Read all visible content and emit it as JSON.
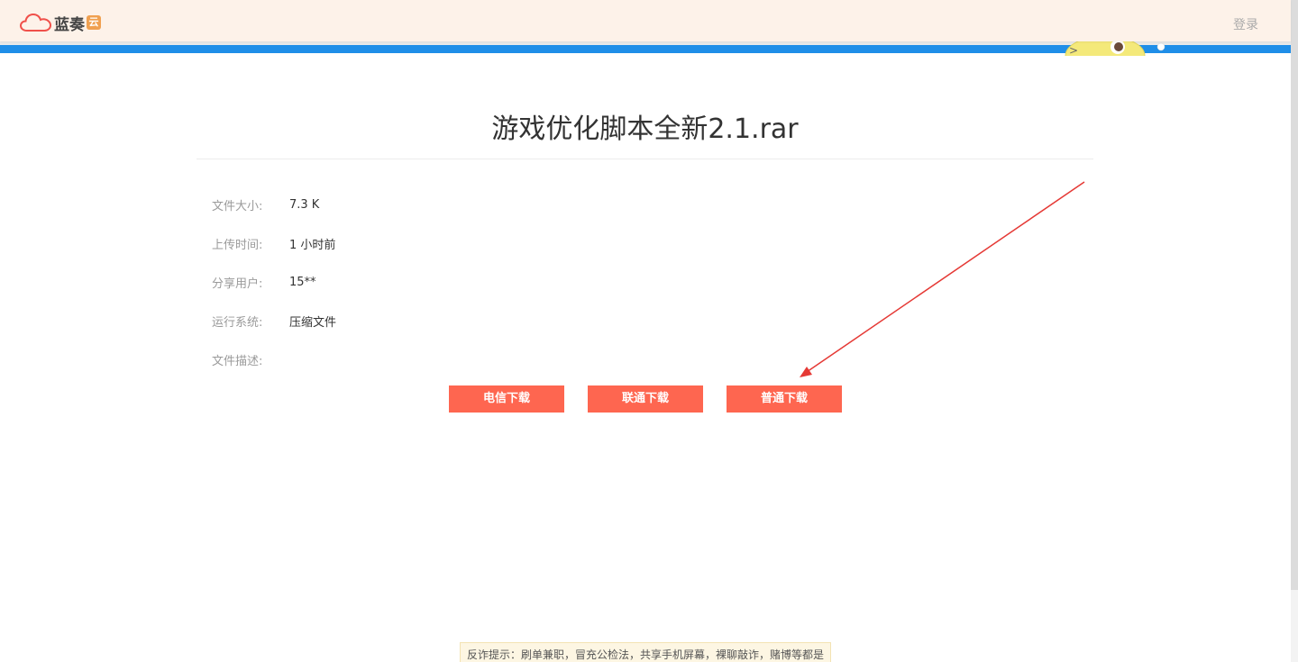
{
  "header": {
    "logo_text": "蓝奏",
    "logo_badge": "云",
    "login_label": "登录"
  },
  "file": {
    "title": "游戏优化脚本全新2.1.rar"
  },
  "info": [
    {
      "label": "文件大小:",
      "value": "7.3 K"
    },
    {
      "label": "上传时间:",
      "value": "1 小时前"
    },
    {
      "label": "分享用户:",
      "value": "15**"
    },
    {
      "label": "运行系统:",
      "value": "压缩文件"
    },
    {
      "label": "文件描述:",
      "value": ""
    }
  ],
  "buttons": {
    "telecom": "电信下载",
    "unicom": "联通下载",
    "normal": "普通下载"
  },
  "notice": {
    "text": "反诈提示：刷单兼职，冒充公检法，共享手机屏幕，裸聊敲诈，赌博等都是"
  },
  "colors": {
    "header_bg": "#fdf2e9",
    "blue_bar": "#1f8ee8",
    "button": "#fe6650",
    "annotation_arrow": "#e53935"
  },
  "icons": {
    "logo": "cloud-icon"
  }
}
